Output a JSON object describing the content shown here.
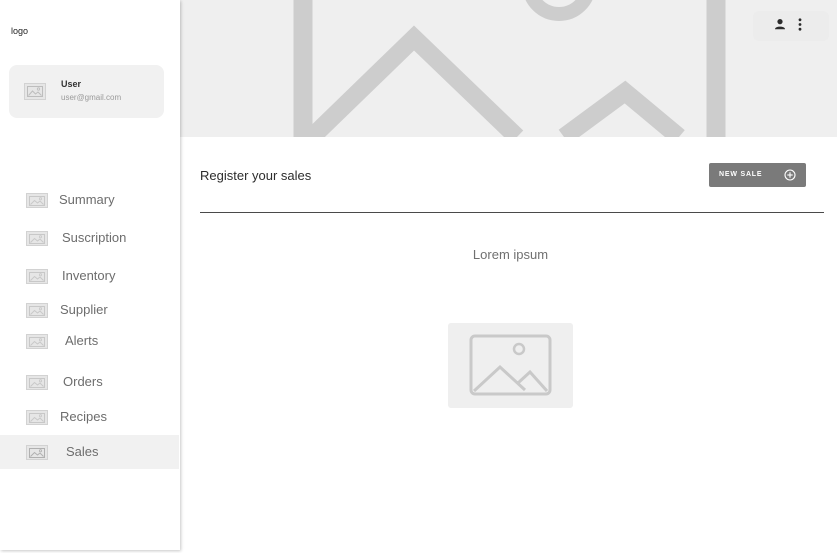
{
  "sidebar": {
    "logo": "logo",
    "user": {
      "name": "User",
      "email": "user@gmail.com",
      "avatar_icon": "image-placeholder-icon"
    },
    "items": [
      {
        "label": "Summary",
        "icon": "image-placeholder-icon",
        "active": false
      },
      {
        "label": "Suscription",
        "icon": "image-placeholder-icon",
        "active": false
      },
      {
        "label": "Inventory",
        "icon": "image-placeholder-icon",
        "active": false
      },
      {
        "label": "Supplier",
        "icon": "image-placeholder-icon",
        "active": false
      },
      {
        "label": "Alerts",
        "icon": "image-placeholder-icon",
        "active": false
      },
      {
        "label": "Orders",
        "icon": "image-placeholder-icon",
        "active": false
      },
      {
        "label": "Recipes",
        "icon": "image-placeholder-icon",
        "active": false
      },
      {
        "label": "Sales",
        "icon": "image-placeholder-icon",
        "active": true
      }
    ]
  },
  "header": {
    "banner_icon": "image-placeholder-icon",
    "actions": [
      {
        "icon": "person-icon"
      },
      {
        "icon": "more-vertical-icon"
      }
    ]
  },
  "main": {
    "title": "Register your sales",
    "new_sale_label": "NEW SALE",
    "new_sale_icon": "add-circle-icon",
    "empty_state_text": "Lorem ipsum",
    "empty_state_icon": "image-placeholder-icon"
  },
  "colors": {
    "placeholder_bg": "#efefef",
    "placeholder_stroke": "#c8c8c8",
    "active_item_bg": "#f1f1f1",
    "button_bg": "#7a7a7a",
    "divider": "#4a4a4a"
  }
}
